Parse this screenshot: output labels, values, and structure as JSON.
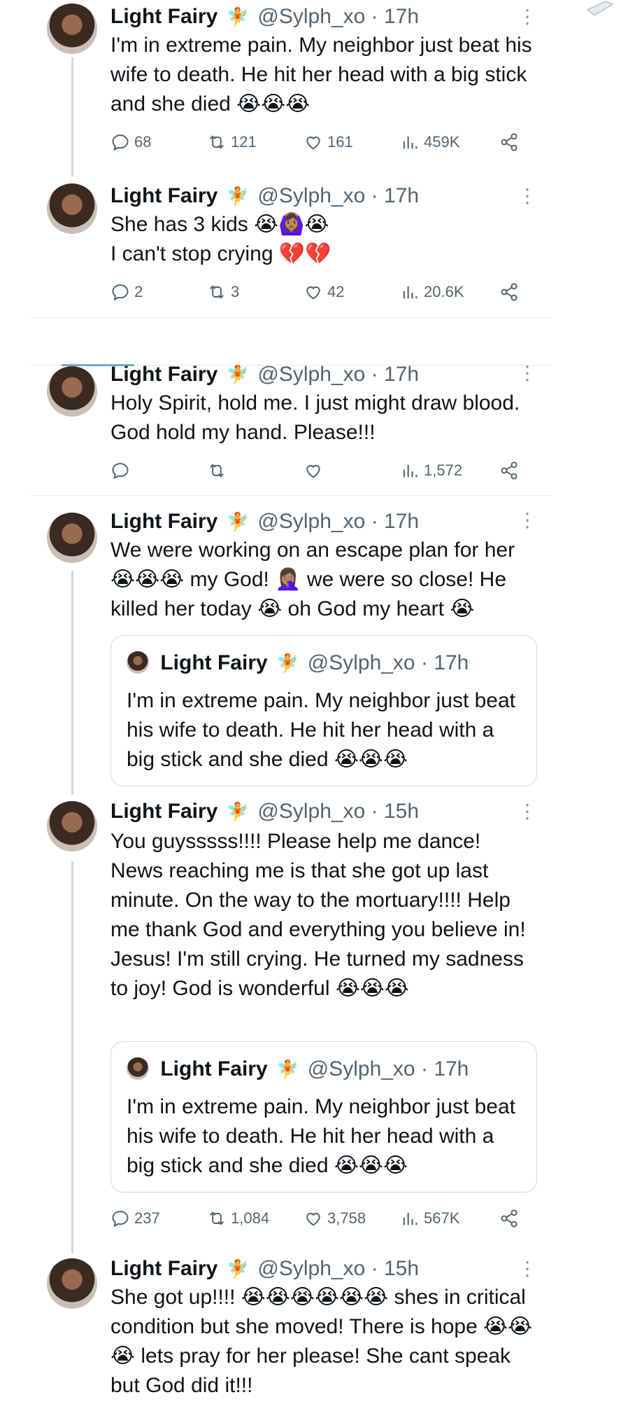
{
  "author": {
    "name": "Light Fairy",
    "emoji": "🧚",
    "handle": "@Sylph_xo",
    "separator": "·"
  },
  "icons": {
    "reply": "reply-icon",
    "retweet": "retweet-icon",
    "like": "like-icon",
    "views": "views-icon",
    "share": "share-icon",
    "more": "more-icon"
  },
  "tweets": [
    {
      "time": "17h",
      "text": "I'm in extreme pain. My neighbor just beat his wife to death. He hit her head with a big stick and she died 😭😭😭",
      "replies": "68",
      "retweets": "121",
      "likes": "161",
      "views": "459K"
    },
    {
      "time": "17h",
      "text": "She has 3 kids 😭🙆🏽‍♀️😭\nI can't stop crying 💔💔",
      "replies": "2",
      "retweets": "3",
      "likes": "42",
      "views": "20.6K"
    },
    {
      "time": "17h",
      "text": "Holy Spirit, hold me. I just might draw blood. God hold my hand. Please!!!",
      "replies": "",
      "retweets": "",
      "likes": "",
      "views": "1,572"
    },
    {
      "time": "17h",
      "text": "We were working on an escape plan for her 😭😭😭 my God! 🤦🏽‍♀️ we were so close! He killed her today 😭 oh God my heart 😭",
      "quote": {
        "name": "Light Fairy",
        "handle": "@Sylph_xo",
        "time": "17h",
        "text": "I'm in extreme pain. My neighbor just beat his wife to death. He hit her head with a big stick and she died 😭😭😭"
      }
    },
    {
      "time": "15h",
      "text": "You guysssss!!!! Please help me dance! News reaching me is that she got up last minute. On the way to the mortuary!!!! Help me thank God and everything you believe in! Jesus! I'm still crying. He turned my sadness to joy! God is wonderful 😭😭😭",
      "quote": {
        "name": "Light Fairy",
        "handle": "@Sylph_xo",
        "time": "17h",
        "text": "I'm in extreme pain. My neighbor just beat his wife to death. He hit her head with a big stick and she died 😭😭😭"
      },
      "replies": "237",
      "retweets": "1,084",
      "likes": "3,758",
      "views": "567K"
    },
    {
      "time": "15h",
      "text": "She got up!!!! 😭😭😭😭😭😭 shes in critical condition but she moved! There is hope 😭😭😭 lets pray for her please! She cant speak but God did it!!!"
    }
  ]
}
